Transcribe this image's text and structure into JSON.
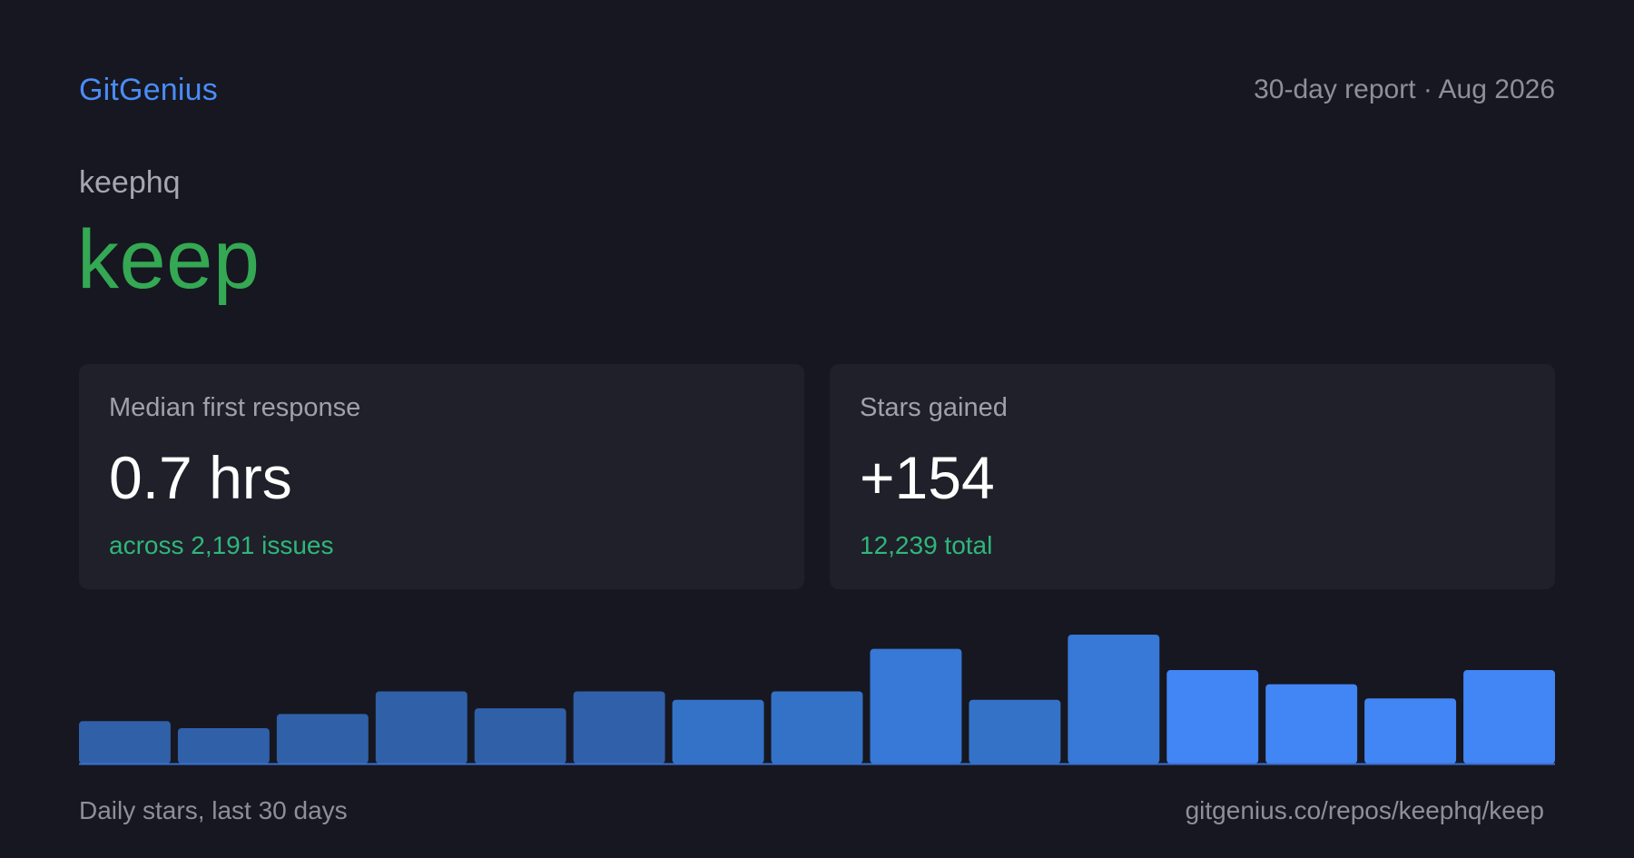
{
  "header": {
    "brand": "GitGenius",
    "report_meta": "30-day report · Aug 2026"
  },
  "repo": {
    "owner": "keephq",
    "name": "keep"
  },
  "cards": [
    {
      "label": "Median first response",
      "value": "0.7 hrs",
      "sub": "across 2,191 issues"
    },
    {
      "label": "Stars gained",
      "value": "+154",
      "sub": "12,239 total"
    }
  ],
  "footer": {
    "caption": "Daily stars, last 30 days",
    "url": "gitgenius.co/repos/keephq/keep"
  },
  "colors": {
    "background": "#161720",
    "card": "#1f2029",
    "brand": "#4a8cf7",
    "repo_name": "#34a853",
    "positive": "#2fb67b"
  },
  "chart_data": {
    "type": "bar",
    "values": [
      30,
      25,
      35,
      51,
      39,
      51,
      45,
      51,
      81,
      45,
      91,
      66,
      56,
      46,
      66
    ],
    "ylim": [
      0,
      100
    ],
    "bar_colors": [
      "#3060a8",
      "#3060a8",
      "#3060a8",
      "#3060a8",
      "#3060a8",
      "#3160aa",
      "#3472c8",
      "#3472c8",
      "#3878d6",
      "#3472c8",
      "#3878d6",
      "#4285f4",
      "#4285f4",
      "#4285f4",
      "#4285f4"
    ],
    "baseline_color": "#3b6fd0"
  }
}
